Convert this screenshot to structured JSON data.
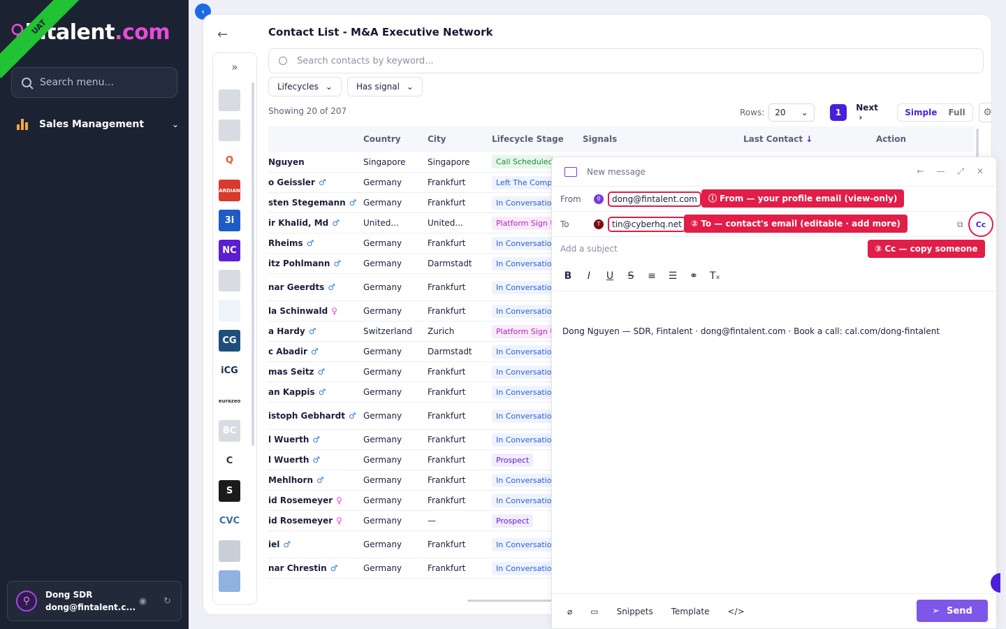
{
  "brand": {
    "text_pre": "",
    "text_main": "intalent",
    "text_suffix": ".com",
    "ribbon": "UAT"
  },
  "sidebar": {
    "search_placeholder": "Search menu...",
    "nav": [
      {
        "label": "Sales Management"
      }
    ],
    "user": {
      "name": "Dong SDR",
      "email": "dong@fintalent.c..."
    }
  },
  "page": {
    "title": "Contact List - M&A Executive Network",
    "search_placeholder": "Search contacts by keyword...",
    "filters": [
      "Lifecycles",
      "Has signal"
    ],
    "showing": "Showing 20 of 207",
    "rows_label": "Rows:",
    "rows_value": "20",
    "page_number": "1",
    "next_label": "Next",
    "view_modes": [
      "Simple",
      "Full"
    ]
  },
  "rail_logos": [
    {
      "text": "",
      "bg": "#d9dbe3"
    },
    {
      "text": "",
      "bg": "#d9dbe3"
    },
    {
      "text": "Q",
      "bg": "#ffffff",
      "fg": "#e8542c"
    },
    {
      "text": "ARDIAN",
      "bg": "#d83a2b"
    },
    {
      "text": "3i",
      "bg": "#1e5bc6"
    },
    {
      "text": "NC",
      "bg": "#5b1fd1"
    },
    {
      "text": "",
      "bg": "#d9dbe3"
    },
    {
      "text": "",
      "bg": "#eef4f8"
    },
    {
      "text": "CG",
      "bg": "#1e4f7a"
    },
    {
      "text": "iCG",
      "bg": "#ffffff",
      "fg": "#0f2f55"
    },
    {
      "text": "eurazeo",
      "bg": "#ffffff",
      "fg": "#333"
    },
    {
      "text": "BC",
      "bg": "#d9dbe3"
    },
    {
      "text": "C",
      "bg": "#ffffff",
      "fg": "#333"
    },
    {
      "text": "S",
      "bg": "#1b1b1b"
    },
    {
      "text": "CVC",
      "bg": "#ffffff",
      "fg": "#3b6ea5"
    },
    {
      "text": "",
      "bg": "#c9ced8"
    },
    {
      "text": "",
      "bg": "#8fb2e0"
    }
  ],
  "table": {
    "headers": [
      "Country",
      "City",
      "Lifecycle Stage",
      "Signals",
      "Last Contact",
      "Action"
    ],
    "rows": [
      {
        "name": "Nguyen",
        "gender": "",
        "country": "Singapore",
        "city": "Singapore",
        "stage": "Call Scheduled",
        "stage_type": "call"
      },
      {
        "name": "o Geissler",
        "gender": "m",
        "country": "Germany",
        "city": "Frankfurt",
        "stage": "Left The Compa",
        "stage_type": "conv"
      },
      {
        "name": "sten Stegemann",
        "gender": "m",
        "country": "Germany",
        "city": "Frankfurt",
        "stage": "In Conversation",
        "stage_type": "conv"
      },
      {
        "name": "ir Khalid, Md",
        "gender": "m",
        "country": "United...",
        "city": "United...",
        "stage": "Platform Sign U",
        "stage_type": "platform"
      },
      {
        "name": "Rheims",
        "gender": "m",
        "country": "Germany",
        "city": "Frankfurt",
        "stage": "In Conversation",
        "stage_type": "conv"
      },
      {
        "name": "itz Pohlmann",
        "gender": "m",
        "country": "Germany",
        "city": "Darmstadt",
        "stage": "In Conversation",
        "stage_type": "conv"
      },
      {
        "name": "nar Geerdts",
        "gender": "m",
        "country": "Germany",
        "city": "Frankfurt",
        "stage": "In Conversation",
        "stage_type": "conv"
      },
      {
        "name": "la Schinwald",
        "gender": "f",
        "country": "Germany",
        "city": "Frankfurt",
        "stage": "In Conversation",
        "stage_type": "conv"
      },
      {
        "name": "a Hardy",
        "gender": "m",
        "country": "Switzerland",
        "city": "Zurich",
        "stage": "Platform Sign U",
        "stage_type": "platform"
      },
      {
        "name": "c Abadir",
        "gender": "m",
        "country": "Germany",
        "city": "Darmstadt",
        "stage": "In Conversation",
        "stage_type": "conv"
      },
      {
        "name": "mas Seitz",
        "gender": "m",
        "country": "Germany",
        "city": "Frankfurt",
        "stage": "In Conversation",
        "stage_type": "conv"
      },
      {
        "name": "an Kappis",
        "gender": "m",
        "country": "Germany",
        "city": "Frankfurt",
        "stage": "In Conversation",
        "stage_type": "conv"
      },
      {
        "name": "istoph Gebhardt",
        "gender": "m",
        "country": "Germany",
        "city": "Frankfurt",
        "stage": "In Conversation",
        "stage_type": "conv"
      },
      {
        "name": "l Wuerth",
        "gender": "m",
        "country": "Germany",
        "city": "Frankfurt",
        "stage": "In Conversation",
        "stage_type": "conv"
      },
      {
        "name": "l Wuerth",
        "gender": "m",
        "country": "Germany",
        "city": "Frankfurt",
        "stage": "Prospect",
        "stage_type": "prospect"
      },
      {
        "name": "Mehlhorn",
        "gender": "m",
        "country": "Germany",
        "city": "Frankfurt",
        "stage": "In Conversation",
        "stage_type": "conv"
      },
      {
        "name": "id Rosemeyer",
        "gender": "f",
        "country": "Germany",
        "city": "Frankfurt",
        "stage": "In Conversation",
        "stage_type": "conv"
      },
      {
        "name": "id Rosemeyer",
        "gender": "f",
        "country": "Germany",
        "city": "—",
        "stage": "Prospect",
        "stage_type": "prospect"
      },
      {
        "name": "iel",
        "gender": "m",
        "country": "Germany",
        "city": "Frankfurt",
        "stage": "In Conversation",
        "stage_type": "conv"
      },
      {
        "name": "nar Chrestin",
        "gender": "m",
        "country": "Germany",
        "city": "Frankfurt",
        "stage": "In Conversation",
        "stage_type": "conv"
      }
    ]
  },
  "compose": {
    "header": "New message",
    "from_label": "From",
    "from_value": "dong@fintalent.com",
    "from_tag": "ⓘ From — your profile email (view-only)",
    "to_label": "To",
    "to_value": "tin@cyberhq.net",
    "to_avatar": "T",
    "to_tag": "② To — contact's email (editable · add more)",
    "cc_label": "Cc",
    "cc_tag": "③ Cc — copy someone",
    "subject_placeholder": "Add a subject",
    "body": "Dong Nguyen — SDR, Fintalent · dong@fintalent.com · Book a call: cal.com/dong-fintalent",
    "footer": [
      "Snippets",
      "Template"
    ],
    "send_label": "Send"
  },
  "colors": {
    "accent": "#4a1fd8",
    "highlight": "#e11d48",
    "sidebar_bg": "#1b2232",
    "brand_pink": "#e74bd8"
  }
}
